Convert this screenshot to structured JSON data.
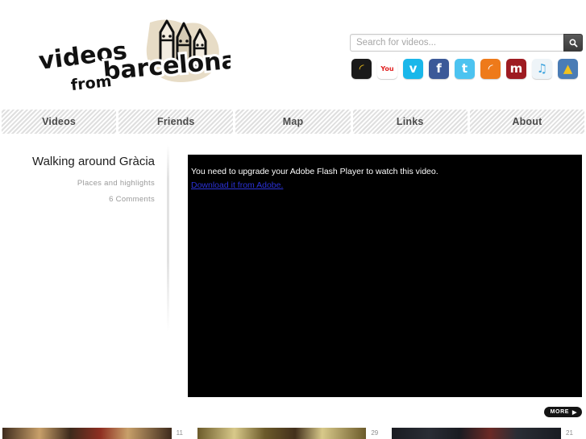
{
  "site": {
    "logo_line1": "videos",
    "logo_line2": "from",
    "logo_line3": "barcelona",
    "logo_name": "videos from barcelona"
  },
  "search": {
    "placeholder": "Search for videos...",
    "value": "",
    "button_icon": "search-icon"
  },
  "social": [
    {
      "name": "rss-black-icon",
      "label": "RSS",
      "glyph": "◜",
      "bg": "#1a1a1a",
      "fg": "#f2c21c"
    },
    {
      "name": "youtube-icon",
      "label": "YouTube",
      "glyph": "You",
      "bg": "#ffffff",
      "fg": "#e02020"
    },
    {
      "name": "vimeo-icon",
      "label": "Vimeo",
      "glyph": "v",
      "bg": "#1ab7ea",
      "fg": "#ffffff"
    },
    {
      "name": "facebook-icon",
      "label": "Facebook",
      "glyph": "f",
      "bg": "#3b5998",
      "fg": "#ffffff"
    },
    {
      "name": "twitter-icon",
      "label": "Twitter",
      "glyph": "t",
      "bg": "#4cc3f0",
      "fg": "#ffffff"
    },
    {
      "name": "rss-orange-icon",
      "label": "RSS Feed",
      "glyph": "◜",
      "bg": "#ee7a1a",
      "fg": "#ffffff"
    },
    {
      "name": "mixcloud-icon",
      "label": "m",
      "glyph": "m",
      "bg": "#9e1b21",
      "fg": "#ffffff"
    },
    {
      "name": "music-icon",
      "label": "Music",
      "glyph": "♫",
      "bg": "#eef4f8",
      "fg": "#3aa2dd"
    },
    {
      "name": "flickr-icon",
      "label": "Photos",
      "glyph": "▲",
      "bg": "#4a7cb5",
      "fg": "#f2c21c"
    }
  ],
  "nav": {
    "tabs": [
      {
        "label": "Videos",
        "name": "videos"
      },
      {
        "label": "Friends",
        "name": "friends"
      },
      {
        "label": "Map",
        "name": "map"
      },
      {
        "label": "Links",
        "name": "links"
      },
      {
        "label": "About",
        "name": "about"
      }
    ]
  },
  "video": {
    "title": "Walking around Gràcia",
    "subtitle": "Places and highlights",
    "comments": "6 Comments"
  },
  "player": {
    "message": "You need to upgrade your Adobe Flash Player to watch this video.",
    "link_text": "Download it from Adobe.",
    "background": "#000000",
    "link_color": "#2b32d8"
  },
  "more": {
    "label": "MORE",
    "arrow": "▶"
  },
  "thumbnails": [
    {
      "count": "11",
      "c1": "#3d2a1c",
      "c2": "#c8a06a",
      "c3": "#8f2f22"
    },
    {
      "count": "29",
      "c1": "#6b5a2a",
      "c2": "#d8c98a",
      "c3": "#43301c"
    },
    {
      "count": "21",
      "c1": "#1a1c22",
      "c2": "#2a2d35",
      "c3": "#6b2a26"
    }
  ]
}
